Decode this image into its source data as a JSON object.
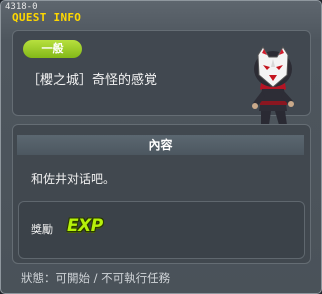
{
  "window": {
    "quest_id": "4318-0",
    "title": "QUEST INFO"
  },
  "quest": {
    "category": "一般",
    "name": "［櫻之城］奇怪的感覚"
  },
  "content": {
    "header": "內容",
    "description": "和佐井对话吧。"
  },
  "reward": {
    "label": "獎勵",
    "exp_text": "EXP"
  },
  "status_text": "狀態：可開始 / 不可執行任務",
  "colors": {
    "title": "#ffd800",
    "category_pill": "#9ccc2a",
    "exp": "#b6f10a"
  },
  "icons": {
    "npc": "fox-mask-ninja-portrait"
  }
}
